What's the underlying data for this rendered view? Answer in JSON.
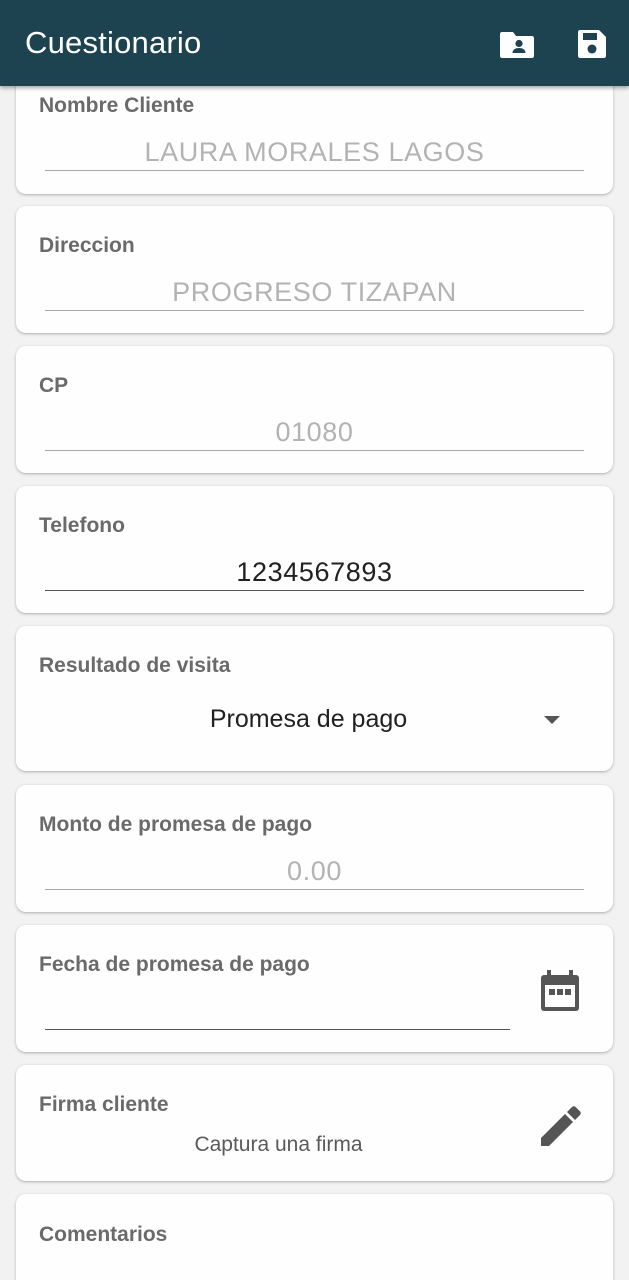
{
  "appbar": {
    "title": "Cuestionario",
    "actions": [
      {
        "icon": "contact-folder-icon"
      },
      {
        "icon": "save-icon"
      }
    ],
    "color": "#1d4350"
  },
  "form": {
    "nombre_cliente": {
      "label": "Nombre Cliente",
      "value": "LAURA MORALES LAGOS"
    },
    "direccion": {
      "label": "Direccion",
      "value": "PROGRESO TIZAPAN"
    },
    "cp": {
      "label": "CP",
      "value": "01080"
    },
    "telefono": {
      "label": "Telefono",
      "value": "1234567893"
    },
    "resultado_visita": {
      "label": "Resultado de visita",
      "value": "Promesa de pago"
    },
    "monto_promesa": {
      "label": "Monto de promesa de pago",
      "value": "0.00"
    },
    "fecha_promesa": {
      "label": "Fecha de promesa de pago",
      "value": "",
      "icon": "calendar-icon"
    },
    "firma_cliente": {
      "label": "Firma cliente",
      "hint": "Captura una firma",
      "icon": "pencil-icon"
    },
    "comentarios": {
      "label": "Comentarios"
    }
  }
}
